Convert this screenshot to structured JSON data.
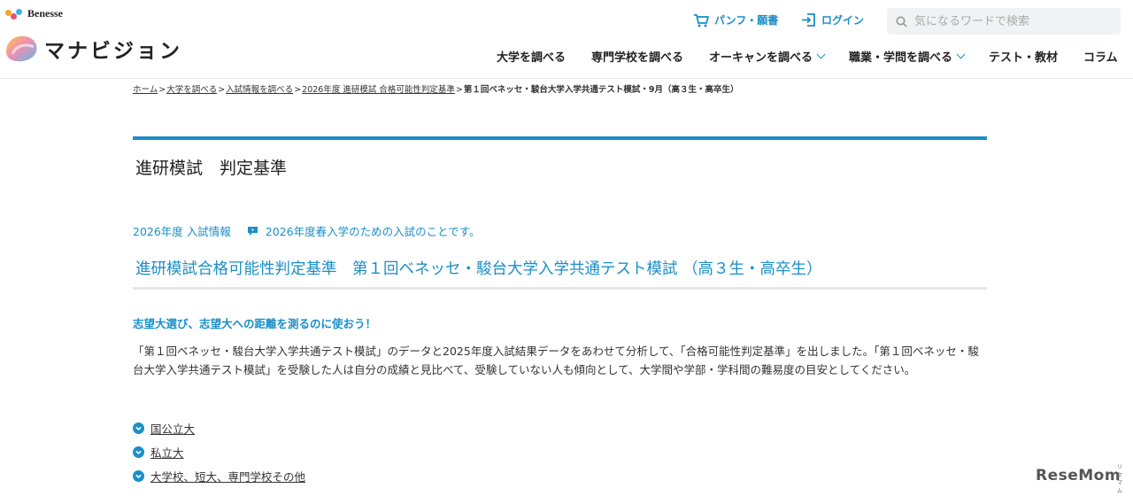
{
  "header": {
    "benesse_label": "Benesse",
    "logo_text": "マナビジョン",
    "pamphlet_label": "パンフ・願書",
    "login_label": "ログイン",
    "search_placeholder": "気になるワードで検索",
    "nav": [
      {
        "label": "大学を調べる"
      },
      {
        "label": "専門学校を調べる"
      },
      {
        "label": "オーキャンを調べる"
      },
      {
        "label": "職業・学問を調べる"
      },
      {
        "label": "テスト・教材"
      },
      {
        "label": "コラム"
      }
    ]
  },
  "breadcrumb": {
    "items": [
      "ホーム",
      "大学を調べる",
      "入試情報を調べる",
      "2026年度 進研模試 合格可能性判定基準"
    ],
    "current": "第１回ベネッセ・駿台大学入学共通テスト模試・9月（高３生・高卒生）",
    "separator": ">"
  },
  "main": {
    "title": "進研模試　判定基準",
    "year_label": "2026年度 入試情報",
    "note": "2026年度春入学のための入試のことです。",
    "subtitle": "進研模試合格可能性判定基準　第１回ベネッセ・駿台大学入学共通テスト模試 （高３生・高卒生）",
    "catch": "志望大選び、志望大への距離を測るのに使おう！",
    "description": "「第１回ベネッセ・駿台大学入学共通テスト模試」のデータと2025年度入試結果データをあわせて分析して、「合格可能性判定基準」を出しました。「第１回ベネッセ・駿台大学入学共通テスト模試」を受験した人は自分の成績と見比べて、受験していない人も傾向として、大学間や学部・学科間の難易度の目安としてください。",
    "links": [
      {
        "label": "国公立大"
      },
      {
        "label": "私立大"
      },
      {
        "label": "大学校、短大、専門学校その他"
      }
    ]
  },
  "watermark": {
    "text": "ReseMom",
    "sub": "リセマム"
  },
  "colors": {
    "accent": "#1a8fc7",
    "text": "#333333",
    "divider": "#e6e6e6"
  }
}
